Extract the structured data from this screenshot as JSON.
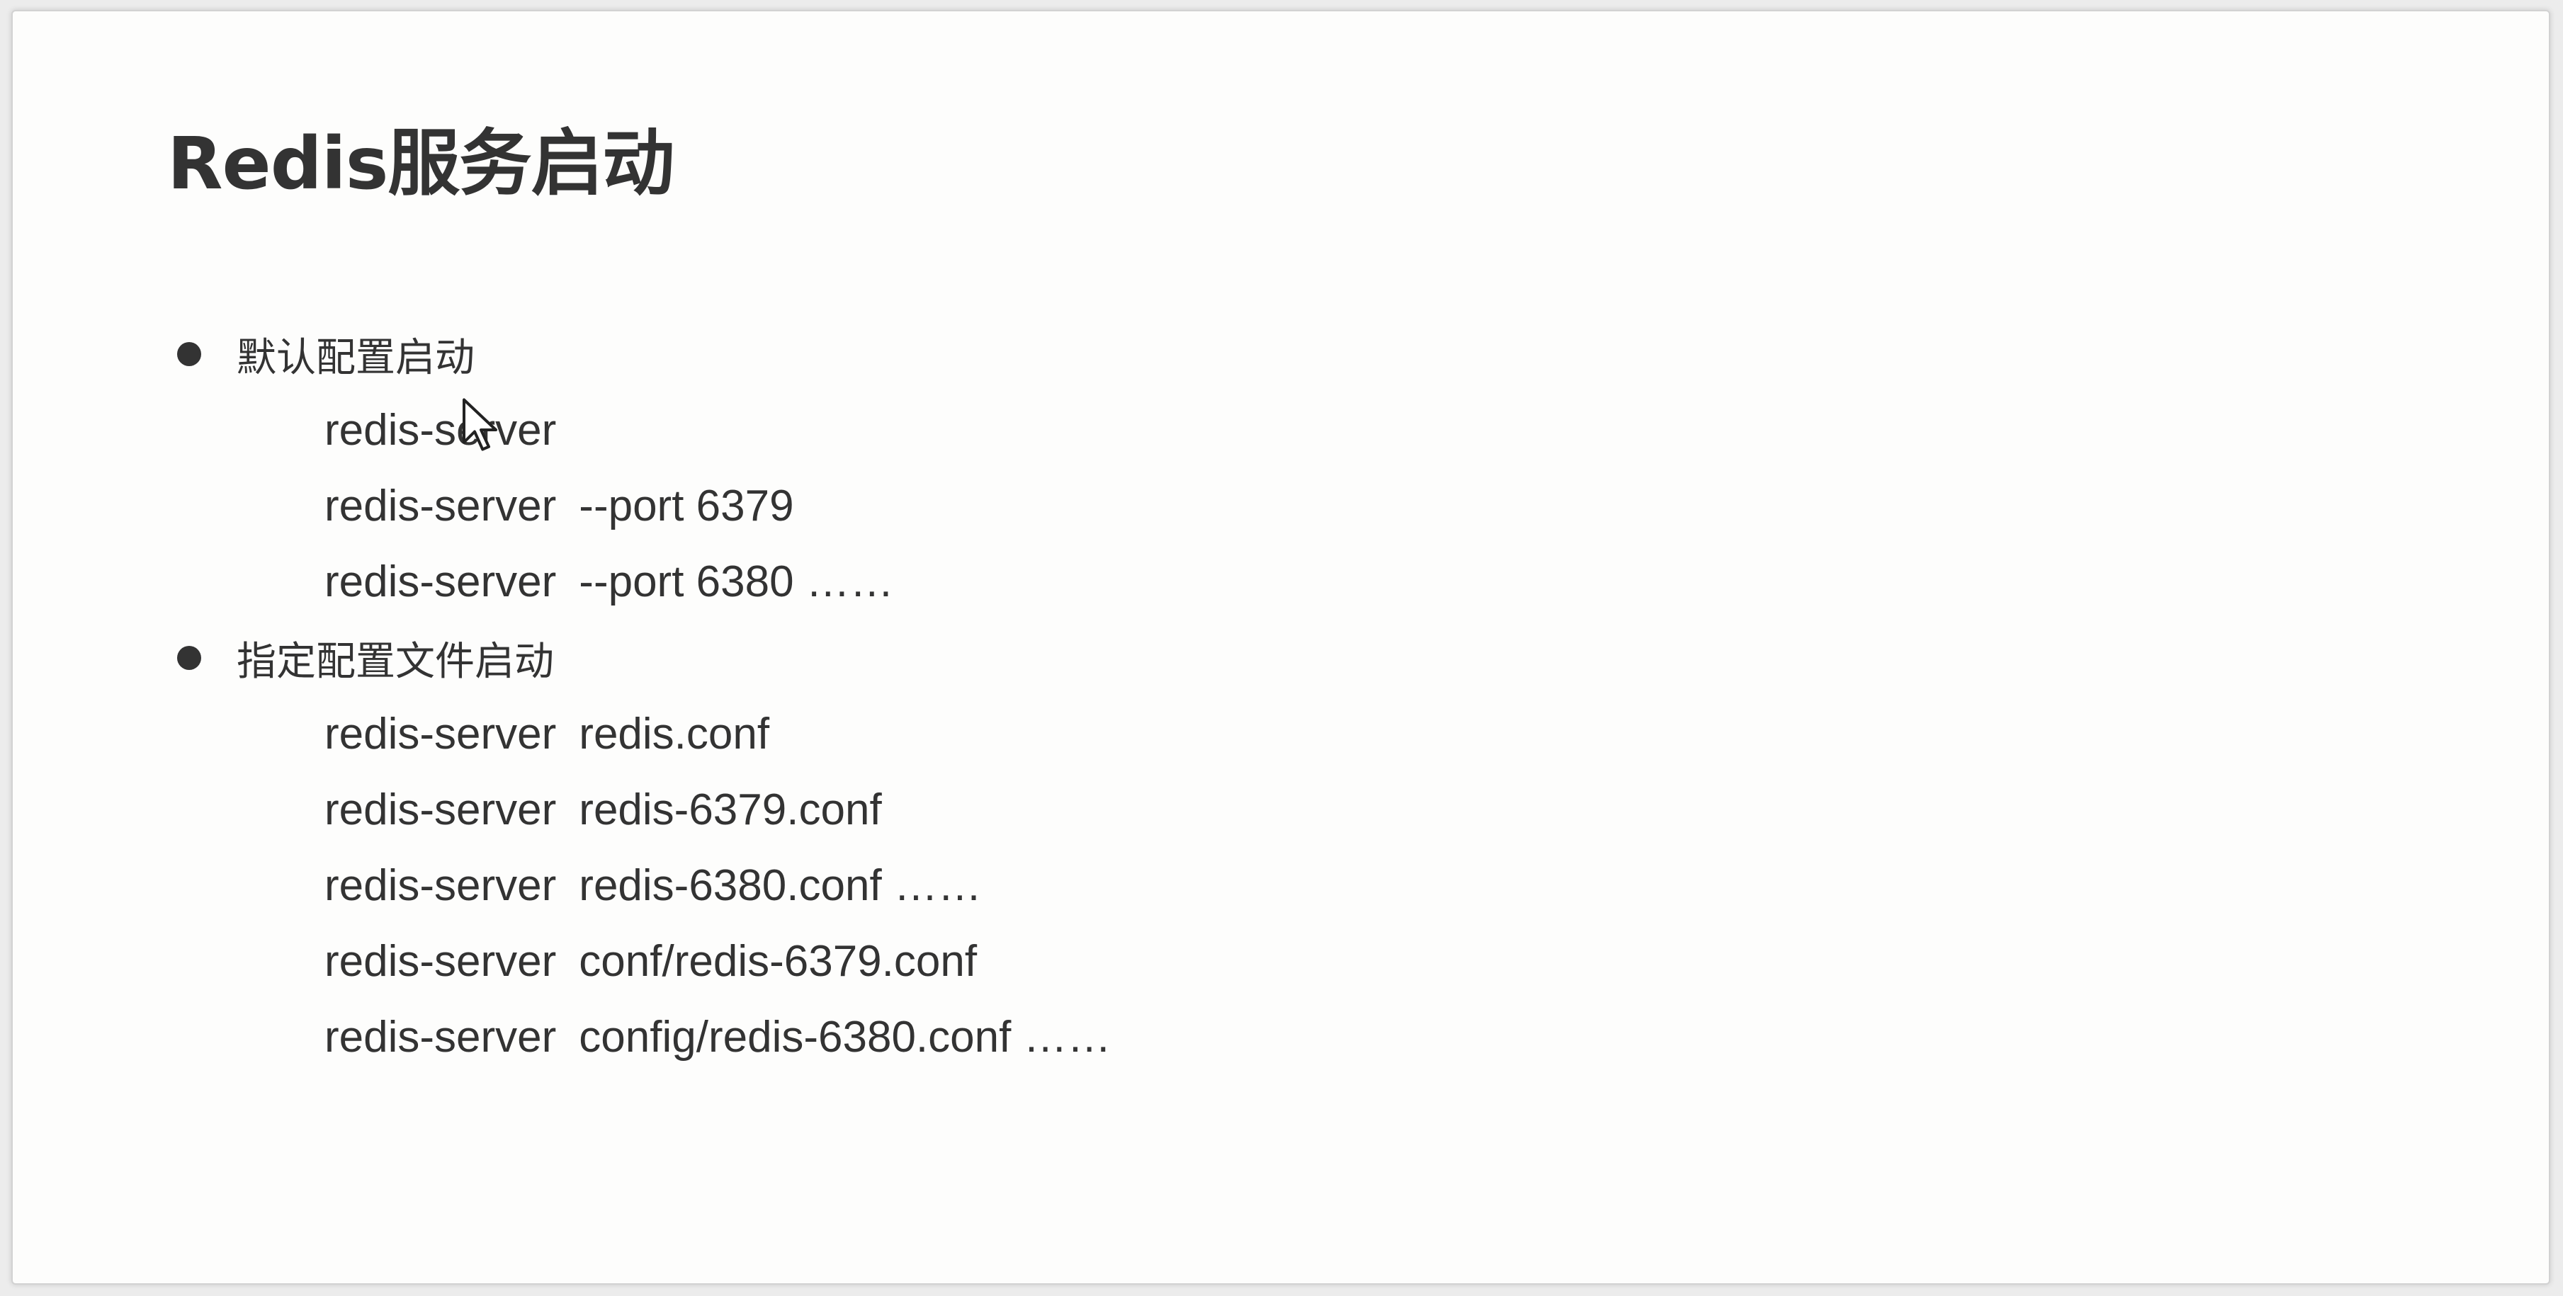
{
  "slide": {
    "title": "Redis服务启动",
    "sections": [
      {
        "heading": "默认配置启动",
        "commands": [
          {
            "name": "redis-server",
            "args": ""
          },
          {
            "name": "redis-server",
            "args": "--port 6379"
          },
          {
            "name": "redis-server",
            "args": "--port 6380 ……"
          }
        ]
      },
      {
        "heading": "指定配置文件启动",
        "commands": [
          {
            "name": "redis-server",
            "args": "redis.conf"
          },
          {
            "name": "redis-server",
            "args": "redis-6379.conf"
          },
          {
            "name": "redis-server",
            "args": "redis-6380.conf ……"
          },
          {
            "name": "redis-server",
            "args": "conf/redis-6379.conf"
          },
          {
            "name": "redis-server",
            "args": "config/redis-6380.conf ……"
          }
        ]
      }
    ]
  },
  "icons": {
    "bullet": "bullet-dot-icon",
    "cursor": "mouse-pointer-icon"
  },
  "colors": {
    "text": "#333333",
    "slide_background": "#fdfdfc",
    "frame_border": "#d2d2d2"
  }
}
